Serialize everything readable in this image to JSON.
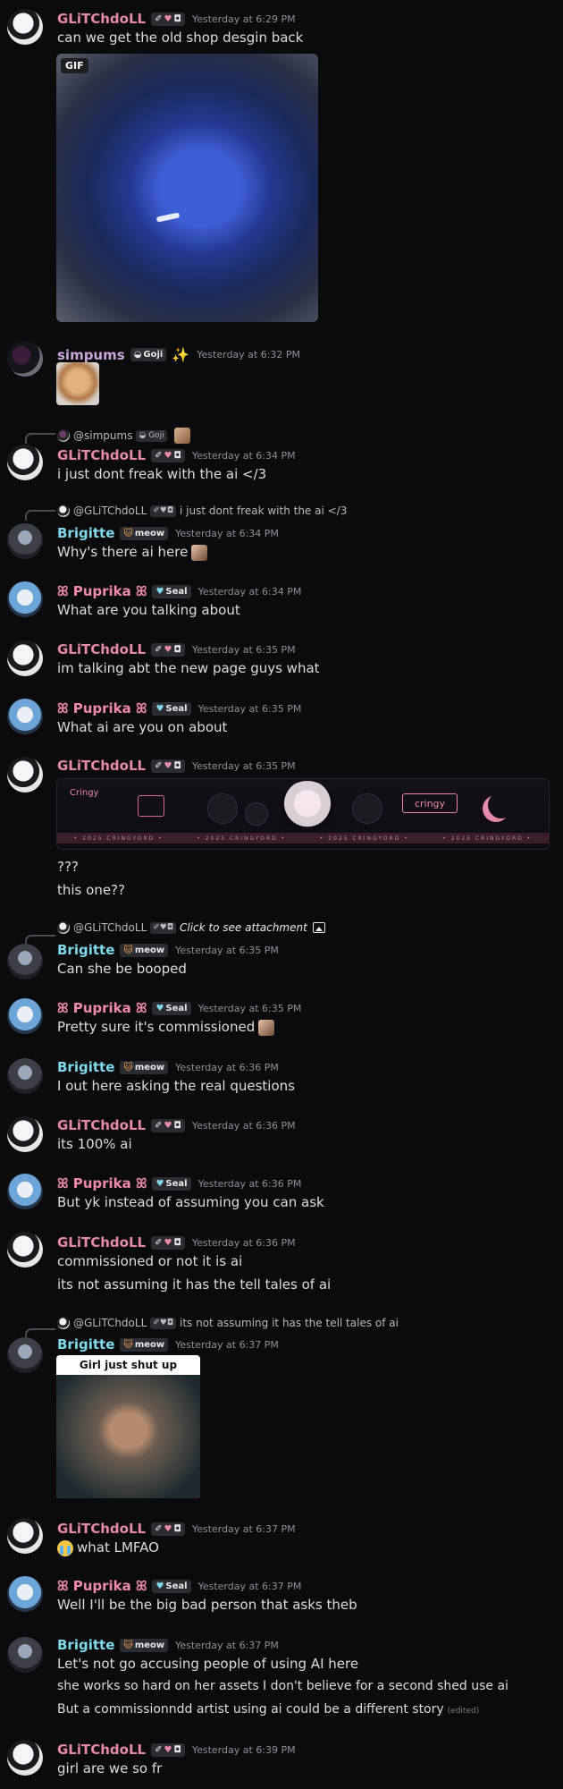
{
  "gif_label": "GIF",
  "banner": {
    "cringy_label": "cringy",
    "strip_text": "• 2025 CRINGYORD •",
    "logo_text": "Cringy"
  },
  "meme_caption": "Girl just shut up",
  "roles": {
    "goji": "Goji",
    "meow": "meow",
    "seal": "Seal"
  },
  "messages": [
    {
      "user": "GLiTChdoLL",
      "time": "Yesterday at 6:29 PM",
      "lines": [
        "can we get the old shop desgin back"
      ]
    },
    {
      "user": "simpums",
      "time": "Yesterday at 6:32 PM",
      "lines": []
    },
    {
      "user": "GLiTChdoLL",
      "time": "Yesterday at 6:34 PM",
      "reply": "@simpums",
      "lines": [
        "i just dont freak with the ai </3"
      ]
    },
    {
      "user": "Brigitte",
      "time": "Yesterday at 6:34 PM",
      "reply": "@GLiTChdoLL",
      "reply_text": "i just dont freak with the ai </3",
      "lines": [
        "Why's there ai here"
      ]
    },
    {
      "user": "Puprika",
      "time": "Yesterday at 6:34 PM",
      "lines": [
        "What are you talking about"
      ]
    },
    {
      "user": "GLiTChdoLL",
      "time": "Yesterday at 6:35 PM",
      "lines": [
        "im talking abt the new page guys what"
      ]
    },
    {
      "user": "Puprika",
      "time": "Yesterday at 6:35 PM",
      "lines": [
        "What ai are you on about"
      ]
    },
    {
      "user": "GLiTChdoLL",
      "time": "Yesterday at 6:35 PM",
      "lines": [
        "???",
        "this one??"
      ]
    },
    {
      "user": "Brigitte",
      "time": "Yesterday at 6:35 PM",
      "reply": "@GLiTChdoLL",
      "reply_text": "Click to see attachment",
      "lines": [
        "Can she be booped"
      ]
    },
    {
      "user": "Puprika",
      "time": "Yesterday at 6:35 PM",
      "lines": [
        "Pretty sure it's commissioned"
      ]
    },
    {
      "user": "Brigitte",
      "time": "Yesterday at 6:36 PM",
      "lines": [
        "I out here asking the real questions"
      ]
    },
    {
      "user": "GLiTChdoLL",
      "time": "Yesterday at 6:36 PM",
      "lines": [
        "its 100% ai"
      ]
    },
    {
      "user": "Puprika",
      "time": "Yesterday at 6:36 PM",
      "lines": [
        "But yk instead of assuming you can ask"
      ]
    },
    {
      "user": "GLiTChdoLL",
      "time": "Yesterday at 6:36 PM",
      "lines": [
        "commissioned or not it is ai",
        "its not assuming it has the tell tales of ai"
      ]
    },
    {
      "user": "Brigitte",
      "time": "Yesterday at 6:37 PM",
      "reply": "@GLiTChdoLL",
      "reply_text": "its not assuming it has the tell tales of ai",
      "lines": []
    },
    {
      "user": "GLiTChdoLL",
      "time": "Yesterday at 6:37 PM",
      "lines": [
        "what LMFAO"
      ]
    },
    {
      "user": "Puprika",
      "time": "Yesterday at 6:37 PM",
      "lines": [
        "Well I'll be the big bad person that asks theb"
      ]
    },
    {
      "user": "Brigitte",
      "time": "Yesterday at 6:37 PM",
      "lines": [
        "Let's not go accusing people of using AI here",
        "she works so hard on her assets I don't believe for a second shed use ai",
        "But a commissionndd artist using ai could be a different story"
      ],
      "edited": "(edited)"
    },
    {
      "user": "GLiTChdoLL",
      "time": "Yesterday at 6:39 PM",
      "lines": [
        "girl are we so fr"
      ]
    }
  ]
}
